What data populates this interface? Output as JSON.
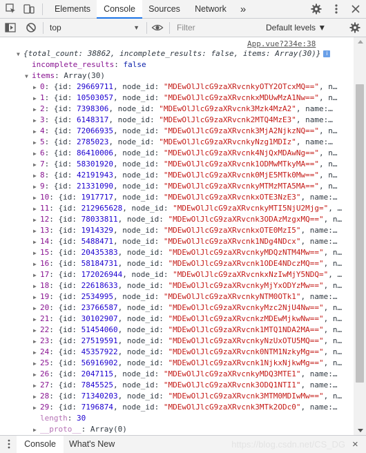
{
  "devtools": {
    "tabs": [
      "Elements",
      "Console",
      "Sources",
      "Network"
    ],
    "more_tabs": "»",
    "active_tab": "Console"
  },
  "toolbar": {
    "context": "top",
    "filter_placeholder": "Filter",
    "levels": "Default levels ▼"
  },
  "log": {
    "source": "App.vue?234e:38",
    "summary": "{total_count: 38862, incomplete_results: false, items: Array(30)}",
    "incomplete_key": "incomplete_results",
    "incomplete_value": "false",
    "items_key": "items",
    "items_type": "Array(30)",
    "items": [
      {
        "i": "0",
        "id": "29669711",
        "node_id": "\"MDEwOlJlcG9zaXRvcnkyOTY2OTcxMQ==\"",
        "tail": ", n…"
      },
      {
        "i": "1",
        "id": "10503057",
        "node_id": "\"MDEwOlJlcG9zaXRvcnkxMDUwMzA1Nw==\"",
        "tail": ", n…"
      },
      {
        "i": "2",
        "id": "7398306",
        "node_id": "\"MDEwOlJlcG9zaXRvcnk3Mzk4MzA2\"",
        "tail": ", name:…"
      },
      {
        "i": "3",
        "id": "6148317",
        "node_id": "\"MDEwOlJlcG9zaXRvcnk2MTQ4MzE3\"",
        "tail": ", name:…"
      },
      {
        "i": "4",
        "id": "72066935",
        "node_id": "\"MDEwOlJlcG9zaXRvcnk3MjA2NjkzNQ==\"",
        "tail": ", n…"
      },
      {
        "i": "5",
        "id": "2785023",
        "node_id": "\"MDEwOlJlcG9zaXRvcnkyNzg1MDIz\"",
        "tail": ", name:…"
      },
      {
        "i": "6",
        "id": "86410006",
        "node_id": "\"MDEwOlJlcG9zaXRvcnk4NjQxMDAwNg==\"",
        "tail": ", n…"
      },
      {
        "i": "7",
        "id": "58301920",
        "node_id": "\"MDEwOlJlcG9zaXRvcnk1ODMwMTkyMA==\"",
        "tail": ", n…"
      },
      {
        "i": "8",
        "id": "42191943",
        "node_id": "\"MDEwOlJlcG9zaXRvcnk0MjE5MTk0Mw==\"",
        "tail": ", n…"
      },
      {
        "i": "9",
        "id": "21331090",
        "node_id": "\"MDEwOlJlcG9zaXRvcnkyMTMzMTA5MA==\"",
        "tail": ", n…"
      },
      {
        "i": "10",
        "id": "1917717",
        "node_id": "\"MDEwOlJlcG9zaXRvcnkxOTE3NzE3\"",
        "tail": ", name:…"
      },
      {
        "i": "11",
        "id": "212965628",
        "node_id": "\"MDEwOlJlcG9zaXRvcnkyMTI5NjU2Mjg=\"",
        "tail": ", …"
      },
      {
        "i": "12",
        "id": "78033811",
        "node_id": "\"MDEwOlJlcG9zaXRvcnk3ODAzMzgxMQ==\"",
        "tail": ", n…"
      },
      {
        "i": "13",
        "id": "1914329",
        "node_id": "\"MDEwOlJlcG9zaXRvcnkxOTE0MzI5\"",
        "tail": ", name:…"
      },
      {
        "i": "14",
        "id": "5488471",
        "node_id": "\"MDEwOlJlcG9zaXRvcnk1NDg4NDcx\"",
        "tail": ", name:…"
      },
      {
        "i": "15",
        "id": "20435383",
        "node_id": "\"MDEwOlJlcG9zaXRvcnkyMDQzNTM4Mw==\"",
        "tail": ", n…"
      },
      {
        "i": "16",
        "id": "58184731",
        "node_id": "\"MDEwOlJlcG9zaXRvcnk1ODE4NDczMQ==\"",
        "tail": ", n…"
      },
      {
        "i": "17",
        "id": "172026944",
        "node_id": "\"MDEwOlJlcG9zaXRvcnkxNzIwMjY5NDQ=\"",
        "tail": ", …"
      },
      {
        "i": "18",
        "id": "22618633",
        "node_id": "\"MDEwOlJlcG9zaXRvcnkyMjYxODYzMw==\"",
        "tail": ", n…"
      },
      {
        "i": "19",
        "id": "2534995",
        "node_id": "\"MDEwOlJlcG9zaXRvcnkyNTM0OTk1\"",
        "tail": ", name:…"
      },
      {
        "i": "20",
        "id": "23766587",
        "node_id": "\"MDEwOlJlcG9zaXRvcnkyMzc2NjU4Nw==\"",
        "tail": ", n…"
      },
      {
        "i": "21",
        "id": "30102907",
        "node_id": "\"MDEwOlJlcG9zaXRvcnkzMDEwMjkwNw==\"",
        "tail": ", n…"
      },
      {
        "i": "22",
        "id": "51454060",
        "node_id": "\"MDEwOlJlcG9zaXRvcnk1MTQ1NDA2MA==\"",
        "tail": ", n…"
      },
      {
        "i": "23",
        "id": "27519591",
        "node_id": "\"MDEwOlJlcG9zaXRvcnkyNzUxOTU5MQ==\"",
        "tail": ", n…"
      },
      {
        "i": "24",
        "id": "45357922",
        "node_id": "\"MDEwOlJlcG9zaXRvcnk0NTM1NzkyMg==\"",
        "tail": ", n…"
      },
      {
        "i": "25",
        "id": "56916902",
        "node_id": "\"MDEwOlJlcG9zaXRvcnk1NjkxNjkwMg==\"",
        "tail": ", n…"
      },
      {
        "i": "26",
        "id": "2047115",
        "node_id": "\"MDEwOlJlcG9zaXRvcnkyMDQ3MTE1\"",
        "tail": ", name:…"
      },
      {
        "i": "27",
        "id": "7845525",
        "node_id": "\"MDEwOlJlcG9zaXRvcnk3ODQ1NTI1\"",
        "tail": ", name:…"
      },
      {
        "i": "28",
        "id": "71340203",
        "node_id": "\"MDEwOlJlcG9zaXRvcnk3MTM0MDIwMw==\"",
        "tail": ", n…"
      },
      {
        "i": "29",
        "id": "7196874",
        "node_id": "\"MDEwOlJlcG9zaXRvcnk3MTk2ODc0\"",
        "tail": ", name:…"
      }
    ],
    "length_key": "length",
    "length_value": "30",
    "proto_key": "__proto__",
    "proto_value": "Array(0)"
  },
  "drawer": {
    "tabs": [
      "Console",
      "What's New"
    ],
    "close": "×"
  },
  "watermark": "https://blog.csdn.net/CS_DG"
}
